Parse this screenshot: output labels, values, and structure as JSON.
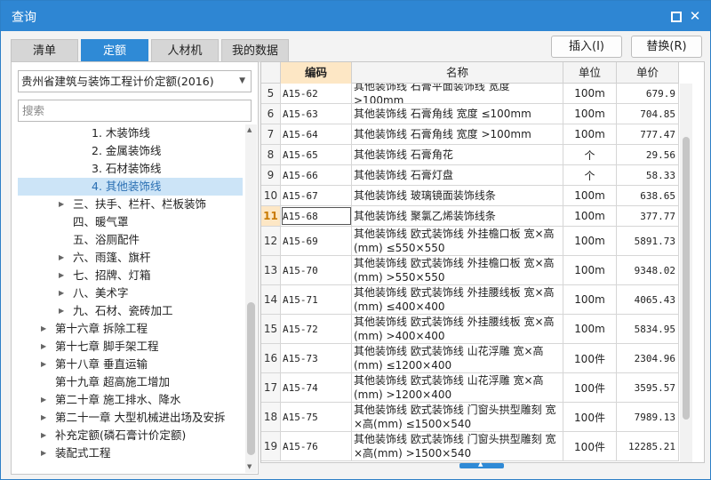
{
  "window": {
    "title": "查询"
  },
  "tabs": [
    "清单",
    "定额",
    "人材机",
    "我的数据"
  ],
  "active_tab": "定额",
  "buttons": {
    "insert": "插入(I)",
    "replace": "替换(R)"
  },
  "library_select": {
    "value": "贵州省建筑与装饰工程计价定额(2016)"
  },
  "search": {
    "placeholder": "搜索"
  },
  "tree": [
    {
      "label": "1. 木装饰线",
      "indent": 83,
      "caret": false
    },
    {
      "label": "2. 金属装饰线",
      "indent": 83,
      "caret": false
    },
    {
      "label": "3. 石材装饰线",
      "indent": 83,
      "caret": false
    },
    {
      "label": "4. 其他装饰线",
      "indent": 83,
      "caret": false,
      "selected": true
    },
    {
      "label": "三、扶手、栏杆、栏板装饰",
      "indent": 62,
      "caret": true
    },
    {
      "label": "四、暖气罩",
      "indent": 62,
      "caret": false
    },
    {
      "label": "五、浴厕配件",
      "indent": 62,
      "caret": false
    },
    {
      "label": "六、雨篷、旗杆",
      "indent": 62,
      "caret": true
    },
    {
      "label": "七、招牌、灯箱",
      "indent": 62,
      "caret": true
    },
    {
      "label": "八、美术字",
      "indent": 62,
      "caret": true
    },
    {
      "label": "九、石材、瓷砖加工",
      "indent": 62,
      "caret": true
    },
    {
      "label": "第十六章 拆除工程",
      "indent": 42,
      "caret": true
    },
    {
      "label": "第十七章 脚手架工程",
      "indent": 42,
      "caret": true
    },
    {
      "label": "第十八章 垂直运输",
      "indent": 42,
      "caret": true
    },
    {
      "label": "第十九章 超高施工增加",
      "indent": 42,
      "caret": false
    },
    {
      "label": "第二十章 施工排水、降水",
      "indent": 42,
      "caret": true
    },
    {
      "label": "第二十一章 大型机械进出场及安拆",
      "indent": 42,
      "caret": true
    },
    {
      "label": "补充定额(磷石膏计价定额)",
      "indent": 42,
      "caret": true
    },
    {
      "label": "装配式工程",
      "indent": 42,
      "caret": true
    }
  ],
  "grid": {
    "headers": {
      "code": "编码",
      "name": "名称",
      "unit": "单位",
      "price": "单价"
    },
    "rows": [
      {
        "no": "5",
        "code": "A15-62",
        "name": "其他装饰线 石膏平面装饰线 宽度 >100mm",
        "unit": "100m",
        "price": "679.9",
        "h": 23
      },
      {
        "no": "6",
        "code": "A15-63",
        "name": "其他装饰线 石膏角线 宽度 ≤100mm",
        "unit": "100m",
        "price": "704.85",
        "h": 23
      },
      {
        "no": "7",
        "code": "A15-64",
        "name": "其他装饰线 石膏角线 宽度 >100mm",
        "unit": "100m",
        "price": "777.47",
        "h": 23
      },
      {
        "no": "8",
        "code": "A15-65",
        "name": "其他装饰线 石膏角花",
        "unit": "个",
        "price": "29.56",
        "h": 23
      },
      {
        "no": "9",
        "code": "A15-66",
        "name": "其他装饰线 石膏灯盘",
        "unit": "个",
        "price": "58.33",
        "h": 23
      },
      {
        "no": "10",
        "code": "A15-67",
        "name": "其他装饰线 玻璃镜面装饰线条",
        "unit": "100m",
        "price": "638.65",
        "h": 23
      },
      {
        "no": "11",
        "code": "A15-68",
        "name": "其他装饰线 聚氯乙烯装饰线条",
        "unit": "100m",
        "price": "377.77",
        "h": 23,
        "current": true
      },
      {
        "no": "12",
        "code": "A15-69",
        "name": "其他装饰线 欧式装饰线 外挂檐口板 宽×高(mm) ≤550×550",
        "unit": "100m",
        "price": "5891.73",
        "h": 33
      },
      {
        "no": "13",
        "code": "A15-70",
        "name": "其他装饰线 欧式装饰线 外挂檐口板 宽×高(mm) >550×550",
        "unit": "100m",
        "price": "9348.02",
        "h": 33
      },
      {
        "no": "14",
        "code": "A15-71",
        "name": "其他装饰线 欧式装饰线 外挂腰线板 宽×高(mm) ≤400×400",
        "unit": "100m",
        "price": "4065.43",
        "h": 33
      },
      {
        "no": "15",
        "code": "A15-72",
        "name": "其他装饰线 欧式装饰线 外挂腰线板 宽×高(mm) >400×400",
        "unit": "100m",
        "price": "5834.95",
        "h": 33
      },
      {
        "no": "16",
        "code": "A15-73",
        "name": "其他装饰线 欧式装饰线 山花浮雕 宽×高(mm) ≤1200×400",
        "unit": "100件",
        "price": "2304.96",
        "h": 33
      },
      {
        "no": "17",
        "code": "A15-74",
        "name": "其他装饰线 欧式装饰线 山花浮雕 宽×高(mm) >1200×400",
        "unit": "100件",
        "price": "3595.57",
        "h": 33
      },
      {
        "no": "18",
        "code": "A15-75",
        "name": "其他装饰线 欧式装饰线 门窗头拱型雕刻 宽×高(mm) ≤1500×540",
        "unit": "100件",
        "price": "7989.13",
        "h": 33
      },
      {
        "no": "19",
        "code": "A15-76",
        "name": "其他装饰线 欧式装饰线 门窗头拱型雕刻 宽×高(mm) >1500×540",
        "unit": "100件",
        "price": "12285.21",
        "h": 33
      }
    ]
  }
}
